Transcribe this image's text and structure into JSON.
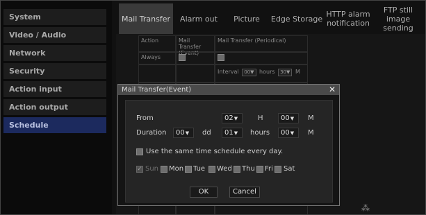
{
  "sidebar": {
    "items": [
      {
        "label": "System"
      },
      {
        "label": "Video / Audio"
      },
      {
        "label": "Network"
      },
      {
        "label": "Security"
      },
      {
        "label": "Action input"
      },
      {
        "label": "Action output"
      },
      {
        "label": "Schedule",
        "active": true
      }
    ]
  },
  "tabs": [
    {
      "label": "Mail Transfer",
      "active": true
    },
    {
      "label": "Alarm out"
    },
    {
      "label": "Picture"
    },
    {
      "label": "Edge Storage"
    },
    {
      "label": "HTTP alarm notification"
    },
    {
      "label": "FTP still image sending"
    }
  ],
  "grid": {
    "header_action": "Action",
    "header_event": "Mail Transfer (Event)",
    "header_periodical": "Mail Transfer (Periodical)",
    "row_always": "Always",
    "interval_label": "Interval",
    "interval_hours_value": "00",
    "interval_hours_unit": "hours",
    "interval_min_value": "30",
    "interval_min_unit": "M"
  },
  "modal": {
    "title": "Mail Transfer(Event)",
    "close_glyph": "✕",
    "from_label": "From",
    "from_hour": "02",
    "from_hour_unit": "H",
    "from_min": "00",
    "from_min_unit": "M",
    "duration_label": "Duration",
    "duration_days": "00",
    "duration_days_unit": "dd",
    "duration_hours": "01",
    "duration_hours_unit": "hours",
    "duration_min": "00",
    "duration_min_unit": "M",
    "same_schedule_label": "Use the same time schedule every day.",
    "days": [
      "Sun",
      "Mon",
      "Tue",
      "Wed",
      "Thu",
      "Fri",
      "Sat"
    ],
    "ok_label": "OK",
    "cancel_label": "Cancel"
  },
  "icons": {
    "dropdown_arrow": "▼",
    "checkmark": "✓",
    "spinner": "⁂"
  }
}
